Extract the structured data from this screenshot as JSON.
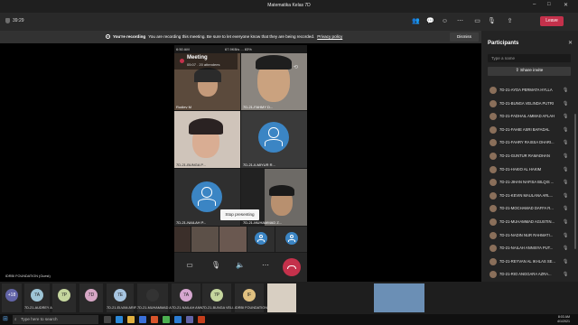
{
  "window": {
    "title": "Matematika Kelas 7D"
  },
  "toolbar": {
    "timer": "39:29",
    "leave_label": "Leave",
    "icons": [
      "people-icon",
      "chat-icon",
      "reactions-icon",
      "more-icon",
      "camera-icon",
      "mic-icon",
      "share-icon"
    ]
  },
  "banner": {
    "title": "You're recording",
    "message": "You are recording this meeting. Be sure to let everyone know that they are being recorded.",
    "link": "Privacy policy",
    "dismiss": "Dismiss"
  },
  "phone": {
    "time": "6:50 AM",
    "status": "67.9KB/s ... 83%",
    "meeting_title": "Meeting",
    "meeting_sub": "05:07 . 20 attendees",
    "stop_presenting": "Stop presenting",
    "tiles": [
      {
        "name": "Rodiev M"
      },
      {
        "name": "7D-21-FAHMY D..."
      },
      {
        "name": "7D-21-BUNGA P..."
      },
      {
        "name": "7D-21-ILMIYUR R..."
      },
      {
        "name": "7D-21-NAILAH P..."
      },
      {
        "name": "7D-21-MUHAMMAD Z..."
      }
    ]
  },
  "stage": {
    "local_label": "IDRBI FOUNDATION (Guest)"
  },
  "panel": {
    "title": "Participants",
    "search_placeholder": "Type a name",
    "share_invite": "Share invite",
    "participants": [
      "7D-21-AYDA PERMATA HYLLA",
      "7D-21-BUNGA VELINDA PUTRI",
      "7D-21-FADHAIL AMMAD AFLAH",
      "7D-21-FAHIE ASRI BAFADAL",
      "7D-21-FAHRY RAISSA DHARI...",
      "7D-21-GUNTUR RAMADHAN",
      "7D-21-HAKIO AL HAKIM",
      "7D-21-JIHAN NAFISA BILQIS ...",
      "7D-21-KEVIN MAULANA ARL...",
      "7D-21-MOCHAMAD DAFFA R...",
      "7D-21-MUHAMMAD AGUSTIN...",
      "7D-21-NADIN NUR RAHMATI...",
      "7D-21-NAILAH ANNISYA PUT...",
      "7D-21-REYVAN AL IKHLAS SE...",
      "7D-21-RIO ANGGARA AZRA..."
    ]
  },
  "strip": [
    {
      "initials": "+18",
      "name": "",
      "color": "#6264a7"
    },
    {
      "initials": "7A",
      "name": "7D-21-AUDREY ARLI...",
      "color": "#9ec5d6"
    },
    {
      "initials": "7P",
      "name": "",
      "color": "#c5d69e"
    },
    {
      "initials": "7D",
      "name": "",
      "color": "#d6a7c5"
    },
    {
      "initials": "7E",
      "name": "7D-21-ELVAN ARIF...",
      "color": "#a7c5e0"
    },
    {
      "initials": "",
      "name": "7D-21-MUHAMMAD A...",
      "color": "#333333"
    },
    {
      "initials": "7A",
      "name": "7D-21-NAILAH ANN...",
      "color": "#d6a7d0"
    },
    {
      "initials": "7P",
      "name": "7D-21-BUNGA VELI...",
      "color": "#c5d69e"
    },
    {
      "initials": "IF",
      "name": "IDRBI FOUNDATION (Guest)",
      "color": "#e0c080"
    },
    {
      "initials": "",
      "name": "",
      "color": "#d8cfc2"
    },
    {
      "initials": "",
      "name": "",
      "color": "#6b8fb5"
    }
  ],
  "taskbar": {
    "search_placeholder": "Type here to search",
    "time": "8:03 AM",
    "date": "4/1/2021"
  }
}
